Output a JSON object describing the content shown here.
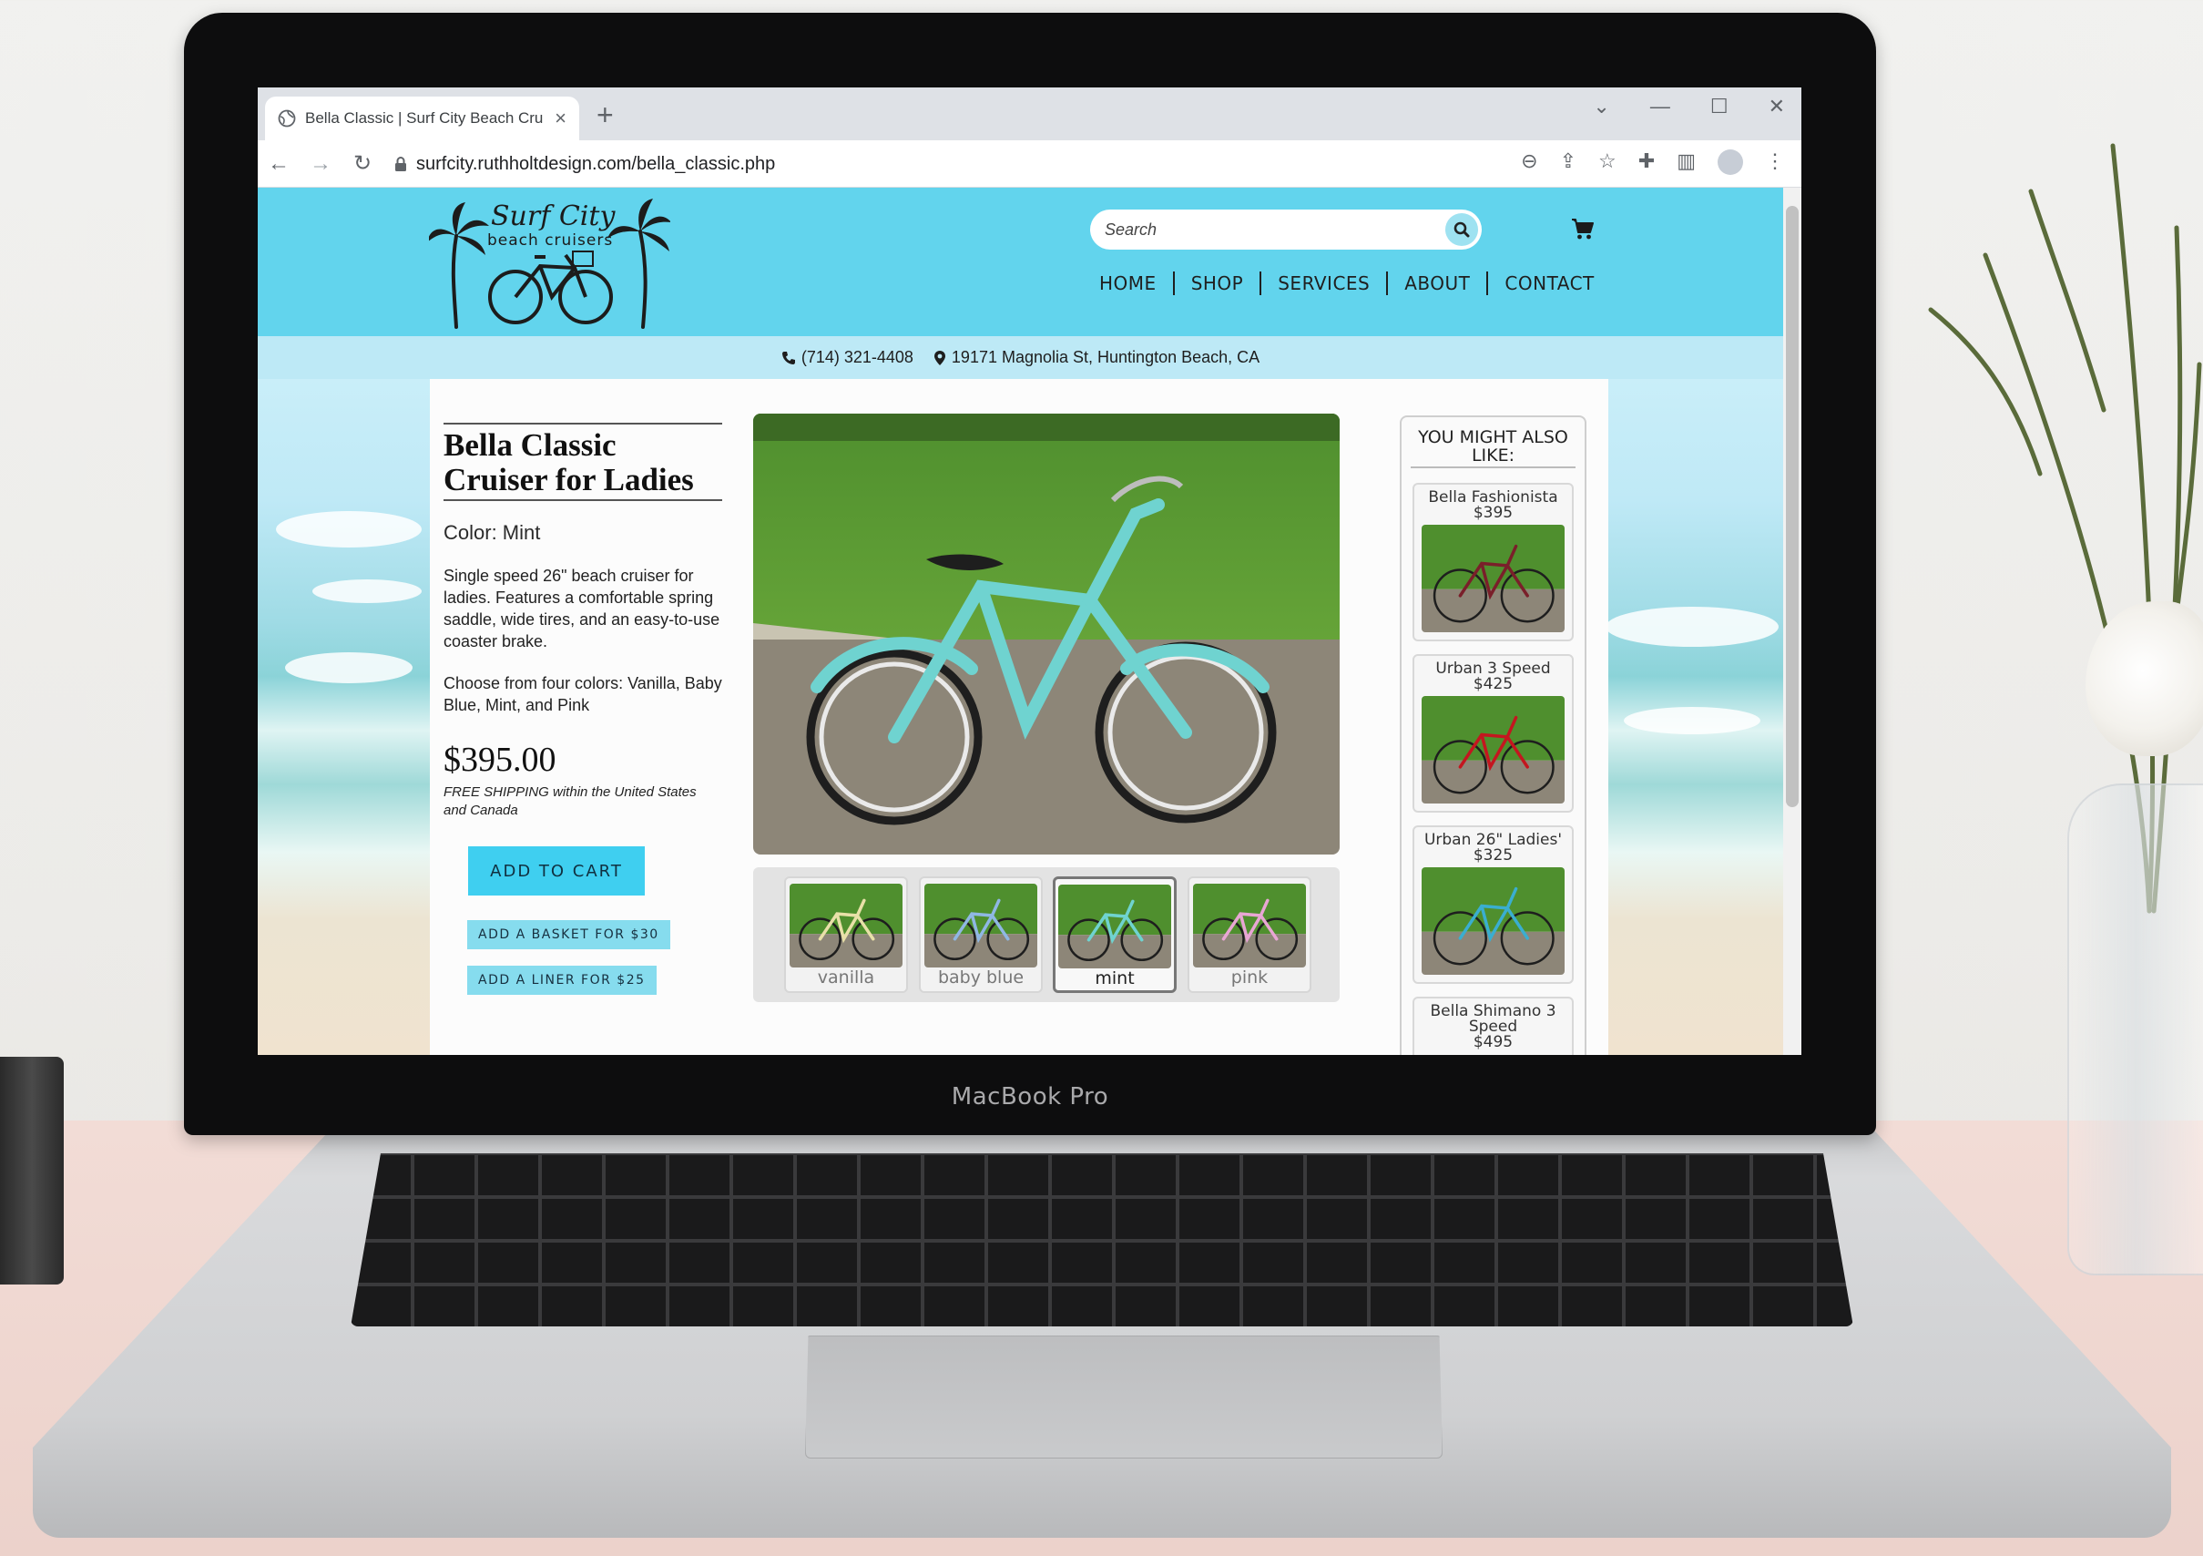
{
  "device": {
    "label": "MacBook Pro"
  },
  "browser": {
    "tab_title": "Bella Classic | Surf City Beach Cru",
    "tab_close": "×",
    "new_tab": "+",
    "url": "surfcity.ruthholtdesign.com/bella_classic.php",
    "win_controls": [
      "⌄",
      "—",
      "☐",
      "✕"
    ]
  },
  "site": {
    "logo": {
      "title": "Surf City",
      "subtitle": "beach cruisers"
    },
    "search": {
      "placeholder": "Search"
    },
    "nav": [
      "HOME",
      "SHOP",
      "SERVICES",
      "ABOUT",
      "CONTACT"
    ],
    "contact": {
      "phone": "(714) 321-4408",
      "address": "19171 Magnolia St, Huntington Beach, CA"
    },
    "colors": {
      "header": "#62d4ed",
      "accent_button": "#3fcff0",
      "addon_button": "#86dcee"
    }
  },
  "product": {
    "title": "Bella Classic Cruiser for Ladies",
    "color_label": "Color: Mint",
    "description": "Single speed 26\" beach cruiser for ladies. Features a comfortable spring saddle, wide tires, and an easy-to-use coaster brake.",
    "colors_text": "Choose from four colors: Vanilla, Baby Blue, Mint, and Pink",
    "price": "$395.00",
    "shipping": "FREE SHIPPING within the United States and Canada",
    "add_to_cart": "ADD TO CART",
    "addons": [
      "ADD A BASKET FOR $30",
      "ADD A LINER FOR $25"
    ],
    "thumbnails": [
      {
        "label": "vanilla",
        "color": "#e8e0a8",
        "selected": false
      },
      {
        "label": "baby blue",
        "color": "#8fb7e3",
        "selected": false
      },
      {
        "label": "mint",
        "color": "#6fd3d0",
        "selected": true
      },
      {
        "label": "pink",
        "color": "#e8a6d4",
        "selected": false
      }
    ]
  },
  "recommendations": {
    "title": "YOU MIGHT ALSO LIKE:",
    "items": [
      {
        "name": "Bella Fashionista",
        "price": "$395",
        "color": "#7a1f2a"
      },
      {
        "name": "Urban 3 Speed",
        "price": "$425",
        "color": "#c4161f"
      },
      {
        "name": "Urban 26\" Ladies'",
        "price": "$325",
        "color": "#3aaed0"
      },
      {
        "name": "Bella Shimano 3 Speed",
        "price": "$495",
        "color": "#222222"
      }
    ]
  }
}
